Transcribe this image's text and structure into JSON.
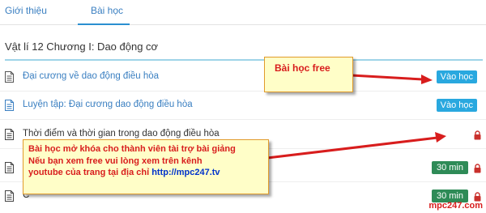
{
  "tabs": [
    {
      "label": "Giới thiệu"
    },
    {
      "label": "Bài học"
    }
  ],
  "chapter_title": "Vật lí 12 Chương I: Dao động cơ",
  "lessons": [
    {
      "title": "Đại cương về dao động điều hòa",
      "action": "Vào học",
      "icon": "document-icon"
    },
    {
      "title": "Luyện tập: Đại cương dao động điều hòa",
      "action": "Vào học",
      "icon": "document-icon"
    },
    {
      "title": "Thời điểm và thời gian trong dao động điều hòa",
      "icon": "document-icon",
      "status_icon": "lock-icon"
    },
    {
      "title": "V",
      "duration": "30 min",
      "icon": "document-icon",
      "status_icon": "lock-icon"
    },
    {
      "title": "C",
      "duration": "30 min",
      "icon": "document-icon",
      "status_icon": "lock-icon"
    }
  ],
  "callouts": {
    "free": "Bài học free",
    "unlock_line1": "Bài học mở khóa cho thành viên tài trợ bài giảng",
    "unlock_line2": "Nếu bạn xem free vui lòng xem trên kênh",
    "unlock_line3": "youtube của trang tại địa chỉ",
    "unlock_url": "http://mpc247.tv"
  },
  "watermark": "mpc247.com",
  "colors": {
    "link": "#3a7fc1",
    "badge": "#29a8df",
    "duration": "#2e8b57",
    "annotation": "#d81d1d",
    "callout_bg": "#fffec8"
  }
}
